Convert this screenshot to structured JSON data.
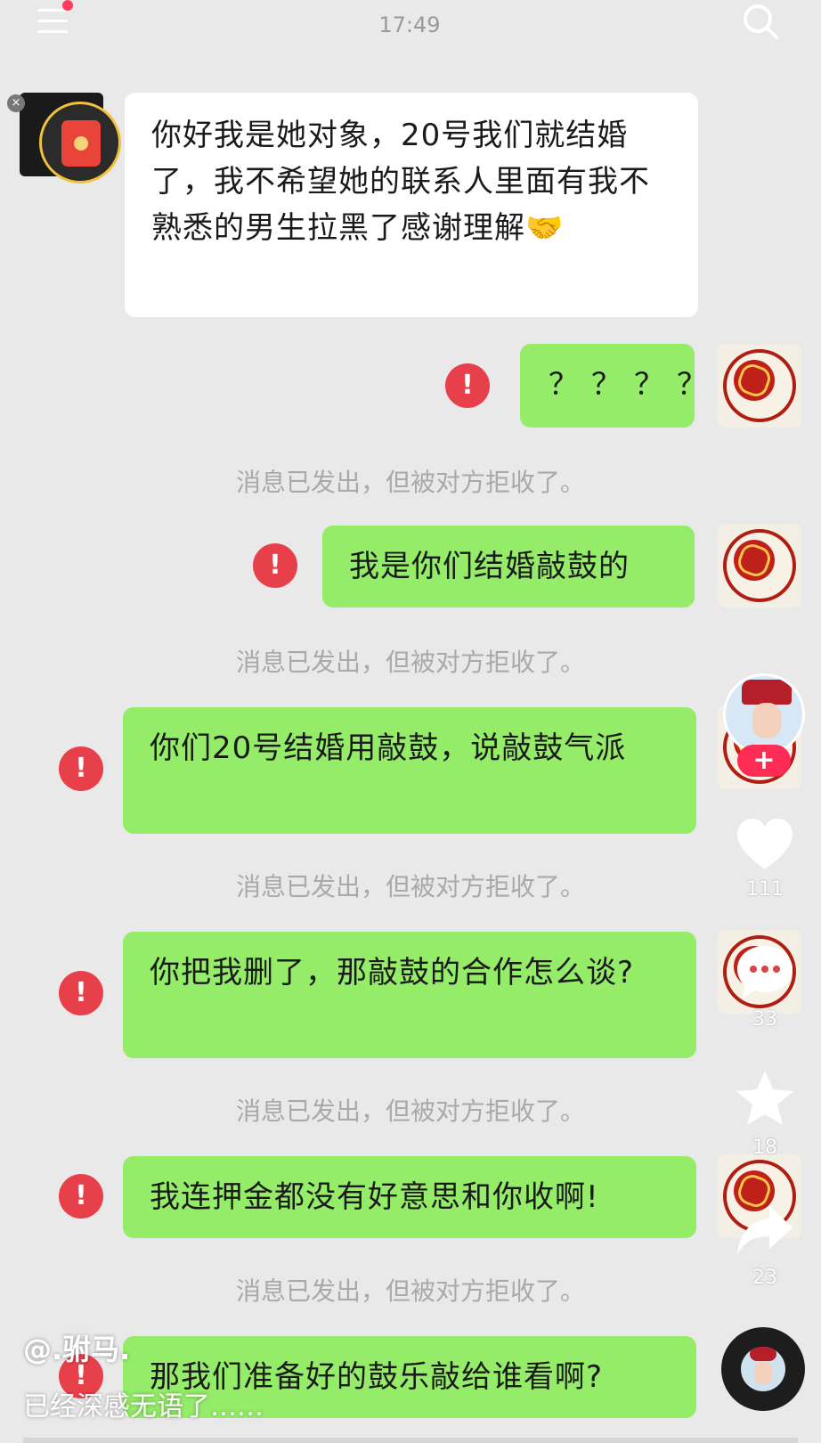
{
  "status_bar": {
    "time": "17:49"
  },
  "chat": {
    "incoming": "你好我是她对象，20号我们就结婚了，我不希望她的联系人里面有我不熟悉的男生拉黑了感谢理解🤝",
    "outgoing": [
      {
        "text": "？？？？",
        "status": "消息已发出，但被对方拒收了。"
      },
      {
        "text": "我是你们结婚敲鼓的",
        "status": "消息已发出，但被对方拒收了。"
      },
      {
        "text": "你们20号结婚用敲鼓，说敲鼓气派",
        "status": "消息已发出，但被对方拒收了。"
      },
      {
        "text": "你把我删了，那敲鼓的合作怎么谈?",
        "status": "消息已发出，但被对方拒收了。"
      },
      {
        "text": "我连押金都没有好意思和你收啊!",
        "status": "消息已发出，但被对方拒收了。"
      },
      {
        "text": "那我们准备好的鼓乐敲给谁看啊?"
      }
    ],
    "error_mark": "!",
    "close_mark": "×"
  },
  "video_ui": {
    "follow_label": "+",
    "likes": "111",
    "comments": "33",
    "favorites": "18",
    "shares": "23",
    "username": "@.驸马.",
    "caption": "已经深感无语了……",
    "icons": [
      "menu-icon",
      "search-icon",
      "heart-icon",
      "comment-icon",
      "star-icon",
      "share-icon",
      "music-disc-icon"
    ]
  },
  "colors": {
    "green_bubble": "#95ec69",
    "white_bubble": "#ffffff",
    "error_red": "#e8404a",
    "background": "#e9e9e9"
  }
}
